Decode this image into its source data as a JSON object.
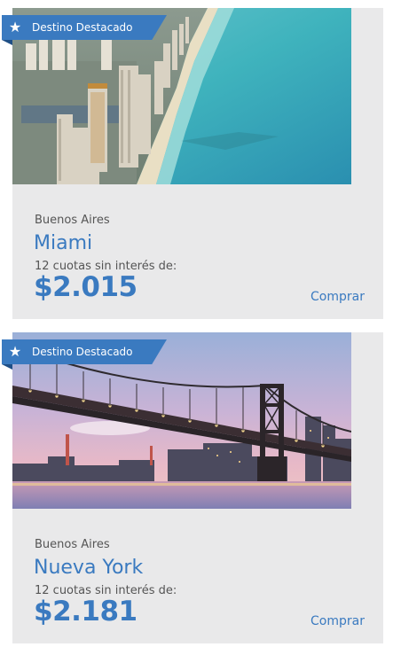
{
  "accent_color": "#3a7ac0",
  "cards": [
    {
      "badge": {
        "icon": "star-icon",
        "label": "Destino Destacado"
      },
      "image": "miami-beach-skyline-photo",
      "origin": "Buenos Aires",
      "destination": "Miami",
      "installments_text": "12 cuotas sin interés de:",
      "price": "$2.015",
      "buy_label": "Comprar"
    },
    {
      "badge": {
        "icon": "star-icon",
        "label": "Destino Destacado"
      },
      "image": "new-york-bridge-sunset-photo",
      "origin": "Buenos Aires",
      "destination": "Nueva York",
      "installments_text": "12 cuotas sin interés de:",
      "price": "$2.181",
      "buy_label": "Comprar"
    }
  ]
}
